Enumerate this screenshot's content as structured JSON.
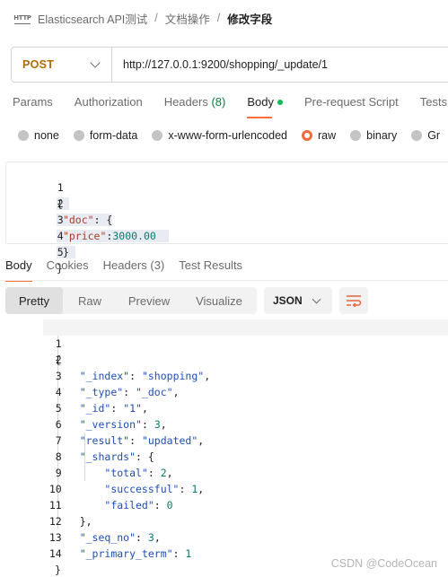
{
  "breadcrumb": {
    "icon": "http-icon",
    "icon_text": "HTTP",
    "collection": "Elasticsearch API测试",
    "folder": "文档操作",
    "current": "修改字段"
  },
  "request": {
    "method": "POST",
    "url": "http://127.0.0.1:9200/shopping/_update/1"
  },
  "request_tabs": [
    "Params",
    "Authorization",
    "Headers",
    "(8)",
    "Body",
    "Pre-request Script",
    "Tests"
  ],
  "body_types": {
    "none": "none",
    "form_data": "form-data",
    "urlencoded": "x-www-form-urlencoded",
    "raw": "raw",
    "binary": "binary",
    "graphql_partial": "Gr",
    "selected": "raw"
  },
  "request_body": {
    "line_numbers": [
      "1",
      "2",
      "3",
      "4",
      "5"
    ],
    "open_brace": "{",
    "doc_key": "\"doc\"",
    "colon_brace": ": {",
    "price_key": "\"price\"",
    "colon": ":",
    "price_value": "3000.00",
    "close_inner": "}",
    "close_outer": "}"
  },
  "response_tabs": {
    "body": "Body",
    "cookies": "Cookies",
    "headers": "Headers (3)",
    "test_results": "Test Results"
  },
  "view_modes": {
    "pretty": "Pretty",
    "raw": "Raw",
    "preview": "Preview",
    "visualize": "Visualize",
    "selected": "Pretty"
  },
  "format": "JSON",
  "response": {
    "line_numbers": [
      "1",
      "2",
      "3",
      "4",
      "5",
      "6",
      "7",
      "8",
      "9",
      "10",
      "11",
      "12",
      "13",
      "14"
    ],
    "l1": "{",
    "index_key": "\"_index\"",
    "index_val": "\"shopping\"",
    "type_key": "\"_type\"",
    "type_val": "\"_doc\"",
    "id_key": "\"_id\"",
    "id_val": "\"1\"",
    "version_key": "\"_version\"",
    "version_val": "3",
    "result_key": "\"result\"",
    "result_val": "\"updated\"",
    "shards_key": "\"_shards\"",
    "shards_open": "{",
    "total_key": "\"total\"",
    "total_val": "2",
    "successful_key": "\"successful\"",
    "successful_val": "1",
    "failed_key": "\"failed\"",
    "failed_val": "0",
    "shards_close": "},",
    "seq_key": "\"_seq_no\"",
    "seq_val": "3",
    "term_key": "\"_primary_term\"",
    "term_val": "1",
    "l14": "}"
  },
  "watermark": "CSDN @CodeOcean",
  "colors": {
    "method": "#b36b00",
    "accent": "#ff6c37",
    "body_dot": "#0cbb52",
    "json_key": "#1f4fb3",
    "json_number": "#0b7a6b",
    "request_key": "#a63c29"
  }
}
